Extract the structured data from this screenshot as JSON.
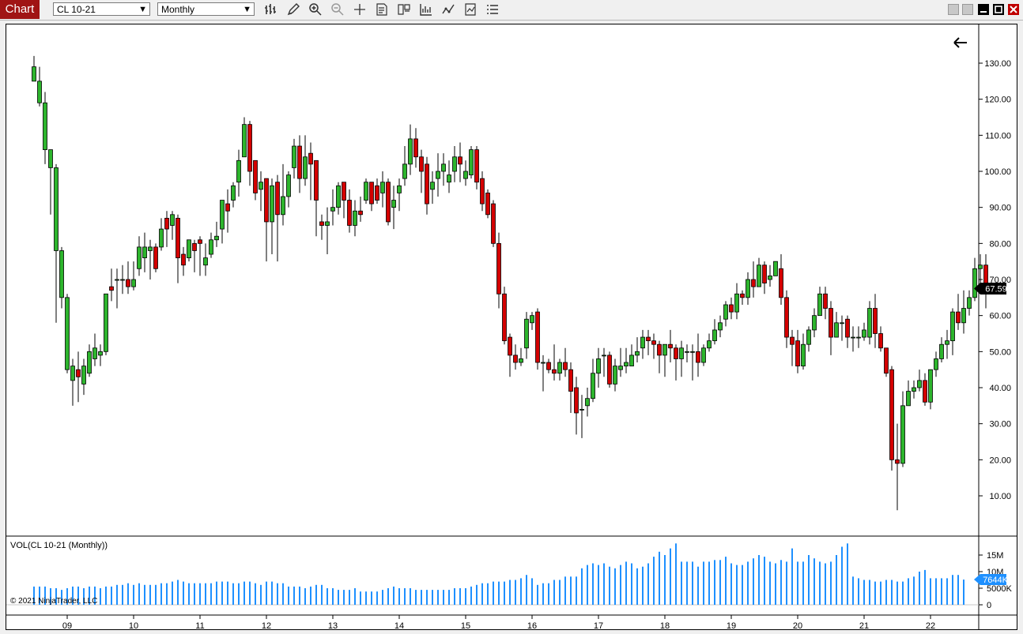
{
  "app": {
    "tab_label": "Chart"
  },
  "toolbar": {
    "instrument": "CL 10-21",
    "period": "Monthly",
    "icons": [
      "bars-type-icon",
      "pencil-icon",
      "zoom-in-icon",
      "zoom-out-icon",
      "crosshair-icon",
      "properties-icon",
      "templates-icon",
      "indicators-icon",
      "strategies-icon",
      "data-box-icon",
      "list-icon"
    ],
    "window_icons": [
      "tile-icon",
      "tile-icon",
      "minimize-icon",
      "maximize-icon",
      "close-icon"
    ]
  },
  "chart": {
    "back_icon": "arrow-left-icon",
    "price_axis_labels": [
      "130.00",
      "120.00",
      "110.00",
      "100.00",
      "90.00",
      "80.00",
      "70.00",
      "60.00",
      "50.00",
      "40.00",
      "30.00",
      "20.00",
      "10.00"
    ],
    "last_price": "67.59",
    "volume_title": "VOL(CL 10-21 (Monthly))",
    "volume_axis_labels": [
      "15M",
      "10M",
      "5000K",
      "0"
    ],
    "last_volume": "7644K",
    "copyright": "© 2021 NinjaTrader, LLC",
    "time_axis_labels": [
      "09",
      "10",
      "11",
      "12",
      "13",
      "14",
      "15",
      "16",
      "17",
      "18",
      "19",
      "20",
      "21",
      "22"
    ],
    "colors": {
      "up": "#2db52d",
      "down": "#d40000",
      "volume": "#1e90ff",
      "label_bg": "#000000",
      "vol_label_bg": "#1e90ff"
    }
  },
  "chart_data": {
    "type": "candlestick",
    "instrument": "CL 10-21",
    "period": "Monthly",
    "ylim": [
      5,
      140
    ],
    "volume_ylim": [
      0,
      20000000
    ],
    "x_range": [
      2008.35,
      2022.0
    ],
    "start": "2008-07",
    "candles": [
      [
        125,
        129,
        126,
        132
      ],
      [
        119,
        125,
        118,
        129
      ],
      [
        106,
        119,
        102,
        122
      ],
      [
        101,
        106,
        88,
        103
      ],
      [
        78,
        101,
        58,
        102
      ],
      [
        65,
        78,
        62,
        79
      ],
      [
        45,
        65,
        44,
        66
      ],
      [
        42,
        46,
        35,
        48
      ],
      [
        45,
        43,
        36,
        50
      ],
      [
        41,
        46,
        38,
        48
      ],
      [
        44,
        50,
        43,
        52
      ],
      [
        48,
        51,
        46,
        55
      ],
      [
        49,
        50,
        46,
        52
      ],
      [
        50,
        66,
        49,
        66
      ],
      [
        68,
        67,
        64,
        73
      ],
      [
        70,
        70,
        62,
        73
      ],
      [
        70,
        70,
        66,
        74
      ],
      [
        70,
        68,
        66,
        75
      ],
      [
        68,
        70,
        67,
        75
      ],
      [
        73,
        79,
        71,
        82
      ],
      [
        76,
        79,
        72,
        83
      ],
      [
        78,
        79,
        70,
        81
      ],
      [
        79,
        73,
        72,
        80
      ],
      [
        79,
        84,
        78,
        87
      ],
      [
        87,
        84,
        79,
        89
      ],
      [
        85,
        88,
        81,
        89
      ],
      [
        87,
        76,
        69,
        88
      ],
      [
        77,
        74,
        71,
        79
      ],
      [
        76,
        81,
        75,
        81
      ],
      [
        80,
        78,
        72,
        81
      ],
      [
        81,
        80,
        71,
        82
      ],
      [
        74,
        76,
        71,
        80
      ],
      [
        77,
        81,
        76,
        83
      ],
      [
        81,
        82,
        79,
        86
      ],
      [
        84,
        92,
        80,
        92
      ],
      [
        91,
        89,
        83,
        95
      ],
      [
        92,
        96,
        90,
        97
      ],
      [
        97,
        103,
        93,
        106
      ],
      [
        104,
        113,
        104,
        115
      ],
      [
        113,
        100,
        96,
        114
      ],
      [
        103,
        94,
        92,
        102
      ],
      [
        95,
        97,
        89,
        100
      ],
      [
        98,
        86,
        75,
        97
      ],
      [
        86,
        96,
        77,
        98
      ],
      [
        97,
        88,
        75,
        99
      ],
      [
        88,
        93,
        85,
        102
      ],
      [
        93,
        99,
        90,
        100
      ],
      [
        101,
        107,
        98,
        109
      ],
      [
        107,
        98,
        94,
        110
      ],
      [
        98,
        104,
        96,
        110
      ],
      [
        105,
        102,
        92,
        108
      ],
      [
        103,
        92,
        82,
        102
      ],
      [
        86,
        85,
        81,
        88
      ],
      [
        85,
        86,
        77,
        90
      ],
      [
        89,
        90,
        85,
        95
      ],
      [
        90,
        96,
        88,
        97
      ],
      [
        97,
        92,
        87,
        97
      ],
      [
        92,
        85,
        83,
        95
      ],
      [
        85,
        89,
        82,
        92
      ],
      [
        89,
        88,
        86,
        93
      ],
      [
        92,
        97,
        91,
        98
      ],
      [
        97,
        91,
        89,
        97
      ],
      [
        96,
        92,
        91,
        98
      ],
      [
        94,
        97,
        90,
        100
      ],
      [
        97,
        86,
        85,
        98
      ],
      [
        90,
        92,
        84,
        96
      ],
      [
        94,
        96,
        89,
        98
      ],
      [
        98,
        102,
        96,
        107
      ],
      [
        102,
        109,
        99,
        113
      ],
      [
        109,
        104,
        101,
        112
      ],
      [
        104,
        100,
        94,
        106
      ],
      [
        102,
        91,
        88,
        104
      ],
      [
        95,
        97,
        91,
        100
      ],
      [
        98,
        100,
        93,
        105
      ],
      [
        100,
        102,
        96,
        105
      ],
      [
        97,
        99,
        94,
        103
      ],
      [
        100,
        104,
        97,
        107
      ],
      [
        104,
        102,
        97,
        108
      ],
      [
        98,
        100,
        96,
        103
      ],
      [
        99,
        106,
        98,
        107
      ],
      [
        106,
        97,
        95,
        107
      ],
      [
        98,
        91,
        89,
        100
      ],
      [
        94,
        88,
        87,
        95
      ],
      [
        91,
        80,
        79,
        92
      ],
      [
        80,
        66,
        62,
        83
      ],
      [
        66,
        53,
        52,
        68
      ],
      [
        54,
        49,
        43,
        55
      ],
      [
        49,
        47,
        45,
        52
      ],
      [
        47,
        48,
        46,
        51
      ],
      [
        51,
        59,
        48,
        61
      ],
      [
        58,
        60,
        56,
        61
      ],
      [
        61,
        47,
        45,
        62
      ],
      [
        47,
        47,
        39,
        49
      ],
      [
        47,
        45,
        44,
        48
      ],
      [
        45,
        44,
        42,
        52
      ],
      [
        44,
        47,
        42,
        48
      ],
      [
        47,
        45,
        43,
        51
      ],
      [
        45,
        39,
        33,
        47
      ],
      [
        40,
        33,
        27,
        43
      ],
      [
        34,
        34,
        26,
        38
      ],
      [
        35,
        37,
        32,
        40
      ],
      [
        37,
        44,
        36,
        48
      ],
      [
        44,
        48,
        40,
        51
      ],
      [
        49,
        49,
        43,
        51
      ],
      [
        49,
        41,
        40,
        50
      ],
      [
        41,
        46,
        39,
        48
      ],
      [
        45,
        46,
        43,
        51
      ],
      [
        46,
        47,
        44,
        51
      ],
      [
        46,
        49,
        46,
        52
      ],
      [
        49,
        50,
        47,
        54
      ],
      [
        51,
        54,
        48,
        56
      ],
      [
        54,
        53,
        49,
        56
      ],
      [
        53,
        52,
        48,
        55
      ],
      [
        52,
        49,
        44,
        53
      ],
      [
        49,
        52,
        43,
        52
      ],
      [
        52,
        51,
        47,
        56
      ],
      [
        51,
        48,
        42,
        52
      ],
      [
        48,
        51,
        43,
        53
      ],
      [
        50,
        50,
        47,
        52
      ],
      [
        50,
        50,
        42,
        52
      ],
      [
        50,
        47,
        43,
        55
      ],
      [
        47,
        51,
        46,
        52
      ],
      [
        51,
        53,
        50,
        55
      ],
      [
        53,
        56,
        52,
        59
      ],
      [
        56,
        58,
        54,
        60
      ],
      [
        59,
        63,
        57,
        64
      ],
      [
        63,
        61,
        59,
        65
      ],
      [
        61,
        66,
        59,
        69
      ],
      [
        66,
        65,
        63,
        67
      ],
      [
        65,
        70,
        63,
        72
      ],
      [
        70,
        68,
        65,
        75
      ],
      [
        68,
        74,
        68,
        76
      ],
      [
        74,
        69,
        66,
        75
      ],
      [
        70,
        71,
        68,
        74
      ],
      [
        71,
        75,
        73,
        73
      ],
      [
        73,
        65,
        63,
        77
      ],
      [
        65,
        54,
        51,
        67
      ],
      [
        54,
        52,
        46,
        56
      ],
      [
        53,
        46,
        44,
        56
      ],
      [
        46,
        52,
        45,
        55
      ],
      [
        52,
        56,
        50,
        57
      ],
      [
        56,
        60,
        54,
        62
      ],
      [
        60,
        66,
        60,
        68
      ],
      [
        66,
        62,
        59,
        68
      ],
      [
        62,
        54,
        49,
        64
      ],
      [
        54,
        58,
        54,
        61
      ],
      [
        58,
        58,
        53,
        60
      ],
      [
        59,
        54,
        51,
        60
      ],
      [
        54,
        54,
        50,
        57
      ],
      [
        54,
        54,
        51,
        57
      ],
      [
        54,
        56,
        53,
        58
      ],
      [
        54,
        62,
        52,
        64
      ],
      [
        62,
        55,
        51,
        66
      ],
      [
        55,
        51,
        50,
        57
      ],
      [
        51,
        44,
        43,
        51
      ],
      [
        45,
        20,
        17,
        46
      ],
      [
        20,
        19,
        6,
        30
      ],
      [
        19,
        35,
        18,
        39
      ],
      [
        35,
        39,
        35,
        42
      ],
      [
        39,
        40,
        37,
        42
      ],
      [
        40,
        42,
        39,
        45
      ],
      [
        42,
        36,
        35,
        44
      ],
      [
        36,
        45,
        34,
        45
      ],
      [
        45,
        48,
        43,
        50
      ],
      [
        48,
        52,
        47,
        54
      ],
      [
        52,
        53,
        48,
        56
      ],
      [
        53,
        61,
        49,
        62
      ],
      [
        61,
        58,
        56,
        66
      ],
      [
        58,
        62,
        55,
        67
      ],
      [
        62,
        65,
        60,
        67
      ],
      [
        65,
        73,
        64,
        76
      ],
      [
        73,
        74,
        68,
        77
      ],
      [
        74,
        67,
        62,
        77
      ]
    ],
    "volume_millions": [
      5.5,
      5.5,
      5.5,
      5,
      5,
      4.5,
      5,
      5.5,
      5.5,
      5,
      5.5,
      5.5,
      5,
      5.5,
      5.5,
      6,
      6,
      6.5,
      6,
      6.5,
      6,
      6,
      6,
      6.5,
      6.5,
      7,
      7.5,
      7,
      6.5,
      6.5,
      6.5,
      6.5,
      6.5,
      7,
      7,
      7,
      6.5,
      6.5,
      7,
      7,
      6.5,
      6,
      7,
      7,
      6.5,
      6.5,
      5.5,
      5.5,
      5.5,
      5,
      5.5,
      6,
      6,
      5,
      5,
      4.5,
      4.5,
      4.5,
      5,
      4,
      4,
      4,
      4,
      4.5,
      5,
      5.5,
      5,
      5,
      5,
      4.5,
      4.5,
      4.5,
      4.5,
      4.5,
      4.5,
      4.5,
      5,
      5,
      5,
      5.5,
      6,
      6.5,
      6.5,
      7,
      7,
      7,
      7.5,
      7.5,
      8,
      9,
      8,
      6,
      6.5,
      6.5,
      7.5,
      7.5,
      8.5,
      8.5,
      8.5,
      11,
      12,
      12.5,
      12,
      12.5,
      11.5,
      11,
      12,
      13,
      12.5,
      11,
      11.5,
      12.5,
      14.5,
      16,
      15,
      17,
      18.5,
      13,
      13,
      13,
      11.5,
      13,
      13,
      13.5,
      13.5,
      14.5,
      12.5,
      12,
      12,
      13,
      14,
      15,
      14.5,
      13,
      12.5,
      13.5,
      13,
      17,
      13,
      13,
      15,
      14,
      13,
      12.5,
      13,
      15,
      17.5,
      18.5,
      8.5,
      8,
      7.5,
      7.5,
      7,
      7,
      7.5,
      7.5,
      7,
      7,
      8,
      8.5,
      10,
      10.5,
      8,
      8,
      8,
      8,
      9,
      9,
      7.6
    ]
  }
}
